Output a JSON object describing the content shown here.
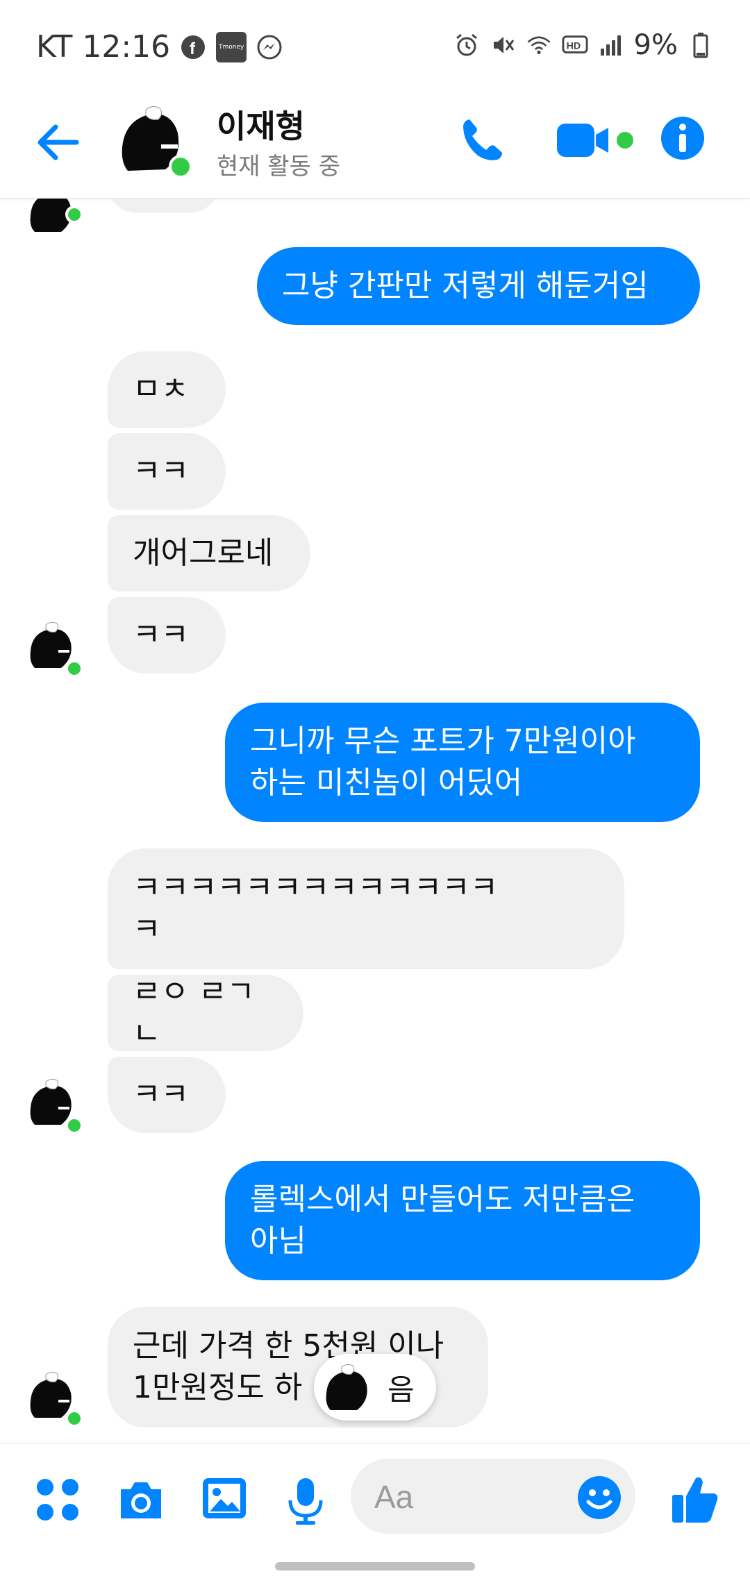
{
  "statusbar": {
    "carrier": "KT",
    "time": "12:16",
    "tmoney": "Tmoney",
    "battery": "9%"
  },
  "header": {
    "name": "이재형",
    "status": "현재 활동 중"
  },
  "messages": [
    {
      "dir": "out",
      "text": "그냥 간판만 저렇게 해둔거임"
    },
    {
      "dir": "in",
      "text": "ㅁㅊ"
    },
    {
      "dir": "in",
      "text": "ㅋㅋ"
    },
    {
      "dir": "in",
      "text": "개어그로네"
    },
    {
      "dir": "in",
      "text": "ㅋㅋ"
    },
    {
      "dir": "out",
      "line1": "그니까 무슨 포트가 7만원이아",
      "line2": "하는 미친놈이 어딨어"
    },
    {
      "dir": "in",
      "line1": "ㅋㅋㅋㅋㅋㅋㅋㅋㅋㅋㅋㅋㅋ",
      "line2": "ㅋ"
    },
    {
      "dir": "in",
      "text": "ㄹㅇ ㄹㄱㄴ"
    },
    {
      "dir": "in",
      "text": "ㅋㅋ"
    },
    {
      "dir": "out",
      "line1": "롤렉스에서 만들어도 저만큼은",
      "line2": "아님"
    },
    {
      "dir": "in",
      "line1": "근데 가격 한 5천원 이나",
      "line2": "1만원정도 하"
    }
  ],
  "typing_chip": {
    "text": "음"
  },
  "composer": {
    "placeholder": "Aa"
  },
  "colors": {
    "accent": "#0084ff",
    "online": "#31cc46",
    "incoming": "#f0f0f0"
  }
}
